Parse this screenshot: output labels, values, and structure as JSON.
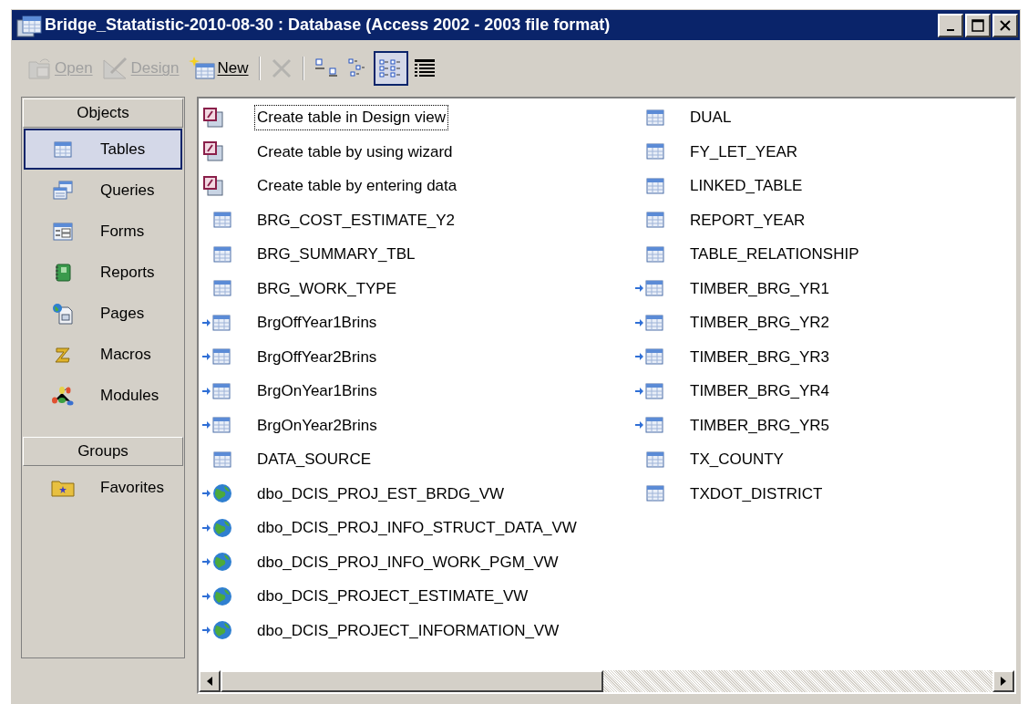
{
  "window": {
    "title": "Bridge_Statatistic-2010-08-30 : Database (Access 2002 - 2003 file format)"
  },
  "toolbar": [
    {
      "kind": "open",
      "label": "Open",
      "disabled": true,
      "selected": false
    },
    {
      "kind": "design",
      "label": "Design",
      "disabled": true,
      "selected": false
    },
    {
      "kind": "new",
      "label": "New",
      "disabled": false,
      "selected": false
    },
    {
      "kind": "separator"
    },
    {
      "kind": "delete",
      "disabled": true,
      "selected": false
    },
    {
      "kind": "separator"
    },
    {
      "kind": "large",
      "disabled": false,
      "selected": false
    },
    {
      "kind": "small",
      "disabled": false,
      "selected": false
    },
    {
      "kind": "list",
      "disabled": false,
      "selected": true
    },
    {
      "kind": "details",
      "disabled": false,
      "selected": false
    }
  ],
  "sidebar": {
    "objects_header": "Objects",
    "objects": [
      {
        "kind": "tables",
        "label": "Tables",
        "selected": true
      },
      {
        "kind": "queries",
        "label": "Queries",
        "selected": false
      },
      {
        "kind": "forms",
        "label": "Forms",
        "selected": false
      },
      {
        "kind": "reports",
        "label": "Reports",
        "selected": false
      },
      {
        "kind": "pages",
        "label": "Pages",
        "selected": false
      },
      {
        "kind": "macros",
        "label": "Macros",
        "selected": false
      },
      {
        "kind": "modules",
        "label": "Modules",
        "selected": false
      }
    ],
    "groups_header": "Groups",
    "groups": [
      {
        "kind": "favorites",
        "label": "Favorites",
        "selected": false
      }
    ]
  },
  "items": [
    {
      "kind": "shortcut",
      "name": "Create table in Design view",
      "focused": true
    },
    {
      "kind": "shortcut",
      "name": "Create table by using wizard",
      "focused": false
    },
    {
      "kind": "shortcut",
      "name": "Create table by entering data",
      "focused": false
    },
    {
      "kind": "table",
      "name": "BRG_COST_ESTIMATE_Y2",
      "focused": false
    },
    {
      "kind": "table",
      "name": "BRG_SUMMARY_TBL",
      "focused": false
    },
    {
      "kind": "table",
      "name": "BRG_WORK_TYPE",
      "focused": false
    },
    {
      "kind": "linked",
      "name": "BrgOffYear1Brins",
      "focused": false
    },
    {
      "kind": "linked",
      "name": "BrgOffYear2Brins",
      "focused": false
    },
    {
      "kind": "linked",
      "name": "BrgOnYear1Brins",
      "focused": false
    },
    {
      "kind": "linked",
      "name": "BrgOnYear2Brins",
      "focused": false
    },
    {
      "kind": "table",
      "name": "DATA_SOURCE",
      "focused": false
    },
    {
      "kind": "odbc",
      "name": "dbo_DCIS_PROJ_EST_BRDG_VW",
      "focused": false
    },
    {
      "kind": "odbc",
      "name": "dbo_DCIS_PROJ_INFO_STRUCT_DATA_VW",
      "focused": false
    },
    {
      "kind": "odbc",
      "name": "dbo_DCIS_PROJ_INFO_WORK_PGM_VW",
      "focused": false
    },
    {
      "kind": "odbc",
      "name": "dbo_DCIS_PROJECT_ESTIMATE_VW",
      "focused": false
    },
    {
      "kind": "odbc",
      "name": "dbo_DCIS_PROJECT_INFORMATION_VW",
      "focused": false
    },
    {
      "kind": "table",
      "name": "DUAL",
      "focused": false
    },
    {
      "kind": "table",
      "name": "FY_LET_YEAR",
      "focused": false
    },
    {
      "kind": "table",
      "name": "LINKED_TABLE",
      "focused": false
    },
    {
      "kind": "table",
      "name": "REPORT_YEAR",
      "focused": false
    },
    {
      "kind": "table",
      "name": "TABLE_RELATIONSHIP",
      "focused": false
    },
    {
      "kind": "linked",
      "name": "TIMBER_BRG_YR1",
      "focused": false
    },
    {
      "kind": "linked",
      "name": "TIMBER_BRG_YR2",
      "focused": false
    },
    {
      "kind": "linked",
      "name": "TIMBER_BRG_YR3",
      "focused": false
    },
    {
      "kind": "linked",
      "name": "TIMBER_BRG_YR4",
      "focused": false
    },
    {
      "kind": "linked",
      "name": "TIMBER_BRG_YR5",
      "focused": false
    },
    {
      "kind": "table",
      "name": "TX_COUNTY",
      "focused": false
    },
    {
      "kind": "table",
      "name": "TXDOT_DISTRICT",
      "focused": false
    }
  ]
}
